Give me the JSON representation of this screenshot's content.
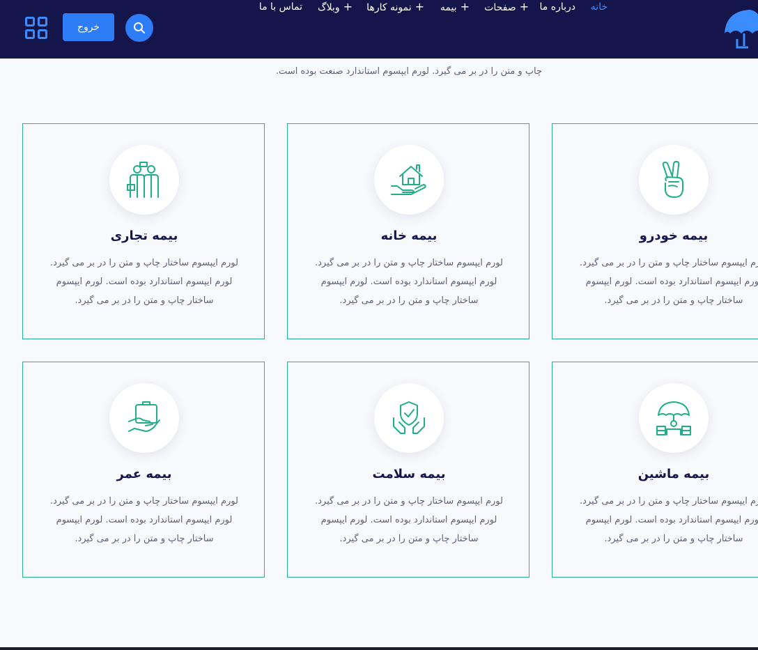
{
  "header": {
    "logo_name": "umbrella-logo",
    "nav": [
      {
        "label": "خانه",
        "has_plus": false,
        "active": true
      },
      {
        "label": "درباره ما",
        "has_plus": false,
        "active": false
      },
      {
        "label": "صفحات",
        "has_plus": true,
        "active": false
      },
      {
        "label": "بیمه",
        "has_plus": true,
        "active": false
      },
      {
        "label": "نمونه کارها",
        "has_plus": true,
        "active": false
      },
      {
        "label": "وبلاگ",
        "has_plus": true,
        "active": false
      },
      {
        "label": "تماس با ما",
        "has_plus": false,
        "active": false
      }
    ],
    "plus_symbol": "+",
    "logout_label": "خروج"
  },
  "intro_text": "چاپ و متن را در بر می گیرد. لورم ایپسوم استاندارد صنعت بوده است.",
  "cards": [
    {
      "title": "بیمه خودرو",
      "icon": "victory-hand-icon",
      "text": "لورم ایپسوم ساختار چاپ و متن را در بر می گیرد. لورم ایپسوم استاندارد بوده است. لورم ایپسوم ساختار چاپ و متن را در بر می گیرد."
    },
    {
      "title": "بیمه خانه",
      "icon": "house-in-hand-icon",
      "text": "لورم ایپسوم ساختار چاپ و متن را در بر می گیرد. لورم ایپسوم استاندارد بوده است. لورم ایپسوم ساختار چاپ و متن را در بر می گیرد."
    },
    {
      "title": "بیمه تجاری",
      "icon": "business-people-icon",
      "text": "لورم ایپسوم ساختار چاپ و متن را در بر می گیرد. لورم ایپسوم استاندارد بوده است. لورم ایپسوم ساختار چاپ و متن را در بر می گیرد."
    },
    {
      "title": "بیمه ماشین",
      "icon": "umbrella-over-machine-icon",
      "text": "لورم ایپسوم ساختار چاپ و متن را در بر می گیرد. لورم ایپسوم استاندارد بوده است. لورم ایپسوم ساختار چاپ و متن را در بر می گیرد."
    },
    {
      "title": "بیمه سلامت",
      "icon": "shield-in-hands-icon",
      "text": "لورم ایپسوم ساختار چاپ و متن را در بر می گیرد. لورم ایپسوم استاندارد بوده است. لورم ایپسوم ساختار چاپ و متن را در بر می گیرد."
    },
    {
      "title": "بیمه عمر",
      "icon": "hand-with-wallet-icon",
      "text": "لورم ایپسوم ساختار چاپ و متن را در بر می گیرد. لورم ایپسوم استاندارد بوده است. لورم ایپسوم ساختار چاپ و متن را در بر می گیرد."
    }
  ],
  "colors": {
    "header_bg": "#14154a",
    "accent_blue": "#2f7df6",
    "card_border": "#24b289",
    "icon_green": "#1fae88",
    "title": "#14154a"
  }
}
